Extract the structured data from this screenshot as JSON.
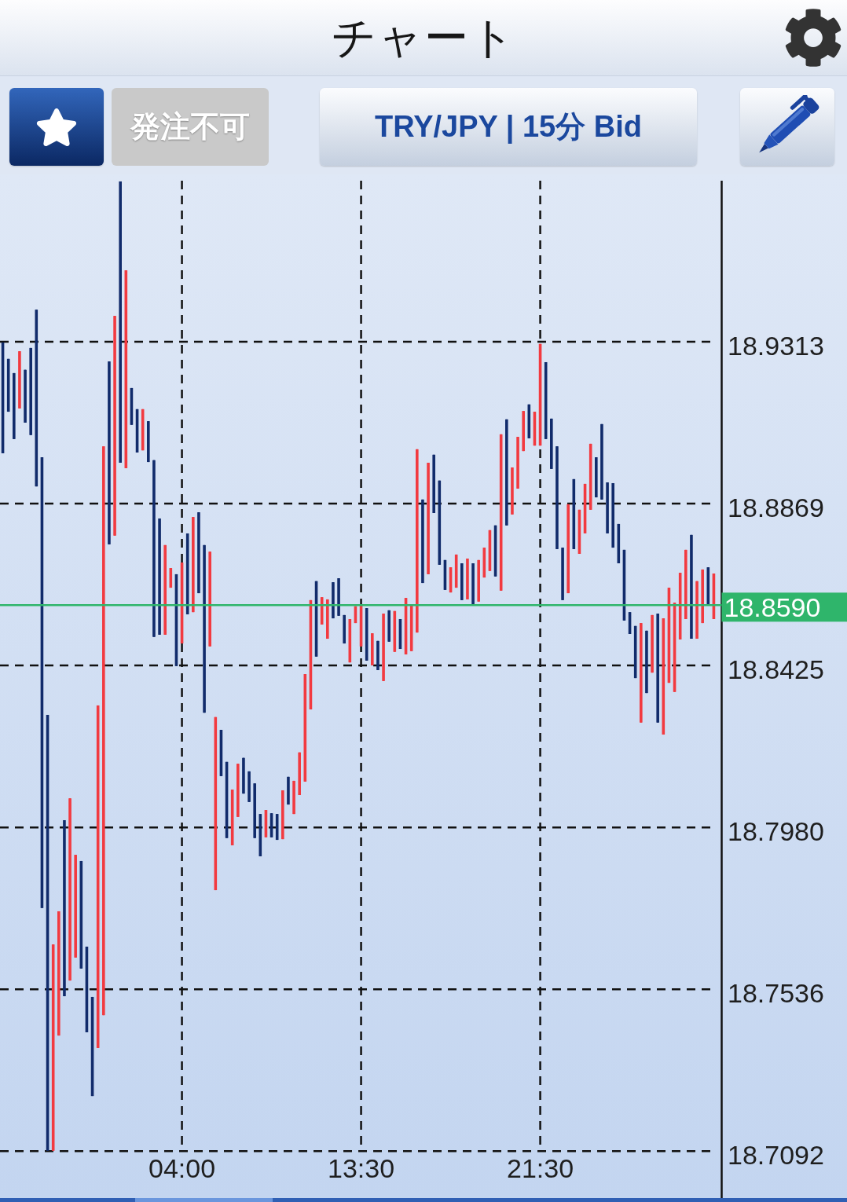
{
  "header": {
    "title": "チャート"
  },
  "toolbar": {
    "order_button": {
      "label": "発注不可",
      "disabled": true
    },
    "symbol_button": {
      "label": "TRY/JPY | 15分 Bid"
    }
  },
  "chart": {
    "chart_data": {
      "type": "candlestick",
      "grid": true,
      "ylim": [
        18.6963,
        18.9755
      ],
      "categories": [
        null,
        null,
        null,
        null,
        null,
        null,
        null,
        null,
        null,
        null,
        null,
        null,
        null,
        null,
        null,
        null,
        null,
        null,
        null,
        null,
        null,
        null,
        null,
        null,
        null,
        null,
        null,
        null,
        null,
        null,
        null,
        null,
        "04:00",
        null,
        null,
        null,
        null,
        null,
        null,
        null,
        null,
        null,
        null,
        null,
        null,
        null,
        null,
        null,
        null,
        null,
        null,
        null,
        null,
        null,
        null,
        null,
        null,
        null,
        null,
        null,
        null,
        null,
        null,
        null,
        "13:30",
        null,
        null,
        null,
        null,
        null,
        null,
        null,
        null,
        null,
        null,
        null,
        null,
        null,
        null,
        null,
        null,
        null,
        null,
        null,
        null,
        null,
        null,
        null,
        null,
        null,
        null,
        null,
        null,
        null,
        null,
        null,
        "21:30",
        null,
        null,
        null,
        null,
        null,
        null,
        null,
        null,
        null,
        null,
        null,
        null,
        null,
        null,
        null,
        null,
        null,
        null,
        null,
        null,
        null,
        null,
        null,
        null,
        null,
        null,
        null,
        null,
        null,
        null,
        null
      ],
      "yticks": [
        {
          "value": 18.9313,
          "label": "18.9313"
        },
        {
          "value": 18.8869,
          "label": "18.8869"
        },
        {
          "value": 18.8425,
          "label": "18.8425"
        },
        {
          "value": 18.798,
          "label": "18.7980"
        },
        {
          "value": 18.7536,
          "label": "18.7536"
        },
        {
          "value": 18.7092,
          "label": "18.7092"
        }
      ],
      "series": [
        {
          "ohlc": [
            [
              18.9311,
              18.9311,
              18.9007,
              18.9007
            ],
            [
              18.9266,
              18.9266,
              18.9121,
              18.9121
            ],
            [
              18.9227,
              18.9227,
              18.9046,
              18.9046
            ],
            [
              18.913,
              18.9287,
              18.913,
              18.9287
            ],
            [
              18.9236,
              18.9236,
              18.9091,
              18.9091
            ],
            [
              18.9296,
              18.9296,
              18.9057,
              18.9057
            ],
            [
              18.9401,
              18.9401,
              18.8916,
              18.8916
            ],
            [
              18.8996,
              18.8996,
              18.7759,
              18.7759
            ],
            [
              18.8289,
              18.8289,
              18.7093,
              18.7093
            ],
            [
              18.7093,
              18.7659,
              18.7093,
              18.7659
            ],
            [
              18.7409,
              18.775,
              18.7409,
              18.775
            ],
            [
              18.8,
              18.8,
              18.7517,
              18.7517
            ],
            [
              18.756,
              18.806,
              18.756,
              18.806
            ],
            [
              18.7623,
              18.7905,
              18.7623,
              18.7905
            ],
            [
              18.7888,
              18.7888,
              18.7593,
              18.7593
            ],
            [
              18.7653,
              18.7653,
              18.7418,
              18.7418
            ],
            [
              18.7515,
              18.7515,
              18.7243,
              18.7243
            ],
            [
              18.7375,
              18.8315,
              18.7375,
              18.8315
            ],
            [
              18.7465,
              18.9026,
              18.7465,
              18.9026
            ],
            [
              18.9259,
              18.9259,
              18.8757,
              18.8757
            ],
            [
              18.8781,
              18.9384,
              18.8781,
              18.9384
            ],
            [
              18.9753,
              18.9753,
              18.8981,
              18.8981
            ],
            [
              18.8966,
              18.9509,
              18.8966,
              18.9509
            ],
            [
              18.9186,
              18.9186,
              18.9085,
              18.9085
            ],
            [
              18.9128,
              18.9128,
              18.9009,
              18.9009
            ],
            [
              18.9015,
              18.9128,
              18.9015,
              18.9128
            ],
            [
              18.9095,
              18.9095,
              18.8983,
              18.8983
            ],
            [
              18.8988,
              18.8988,
              18.8503,
              18.8503
            ],
            [
              18.8828,
              18.8828,
              18.8509,
              18.8509
            ],
            [
              18.8509,
              18.8755,
              18.8509,
              18.8755
            ],
            [
              18.8638,
              18.8692,
              18.8638,
              18.8692
            ],
            [
              18.8675,
              18.8675,
              18.8423,
              18.8423
            ],
            [
              18.8485,
              18.8707,
              18.8485,
              18.8707
            ],
            [
              18.8787,
              18.8787,
              18.8565,
              18.8565
            ],
            [
              18.8571,
              18.8832,
              18.8571,
              18.8832
            ],
            [
              18.8845,
              18.8845,
              18.8623,
              18.8623
            ],
            [
              18.8755,
              18.8755,
              18.8295,
              18.8295
            ],
            [
              18.8477,
              18.8737,
              18.8477,
              18.8737
            ],
            [
              18.7808,
              18.8283,
              18.7808,
              18.8283
            ],
            [
              18.8248,
              18.8248,
              18.8121,
              18.8121
            ],
            [
              18.816,
              18.816,
              18.7951,
              18.7951
            ],
            [
              18.7931,
              18.8084,
              18.7931,
              18.8084
            ],
            [
              18.8009,
              18.8155,
              18.8009,
              18.8155
            ],
            [
              18.8171,
              18.8171,
              18.8073,
              18.8073
            ],
            [
              18.8134,
              18.8134,
              18.805,
              18.805
            ],
            [
              18.8101,
              18.8101,
              18.7951,
              18.7951
            ],
            [
              18.8017,
              18.8017,
              18.7901,
              18.7901
            ],
            [
              18.7953,
              18.8028,
              18.7953,
              18.8028
            ],
            [
              18.8019,
              18.8019,
              18.7953,
              18.7953
            ],
            [
              18.8017,
              18.8017,
              18.7946,
              18.7946
            ],
            [
              18.7948,
              18.8082,
              18.7948,
              18.8082
            ],
            [
              18.8119,
              18.8119,
              18.8043,
              18.8043
            ],
            [
              18.8017,
              18.8108,
              18.8017,
              18.8108
            ],
            [
              18.8069,
              18.8186,
              18.8069,
              18.8186
            ],
            [
              18.8106,
              18.8401,
              18.8106,
              18.8401
            ],
            [
              18.8304,
              18.8604,
              18.8304,
              18.8604
            ],
            [
              18.8656,
              18.8656,
              18.8449,
              18.8449
            ],
            [
              18.8537,
              18.8612,
              18.8537,
              18.8612
            ],
            [
              18.8498,
              18.8606,
              18.8498,
              18.8606
            ],
            [
              18.8653,
              18.8653,
              18.8554,
              18.8554
            ],
            [
              18.8664,
              18.8664,
              18.8561,
              18.8561
            ],
            [
              18.8563,
              18.8563,
              18.8485,
              18.8485
            ],
            [
              18.8433,
              18.8552,
              18.8433,
              18.8552
            ],
            [
              18.8541,
              18.8587,
              18.8541,
              18.8587
            ],
            [
              18.8477,
              18.8591,
              18.8477,
              18.8591
            ],
            [
              18.8582,
              18.8582,
              18.8438,
              18.8438
            ],
            [
              18.8425,
              18.8513,
              18.8425,
              18.8513
            ],
            [
              18.8492,
              18.8492,
              18.8412,
              18.8412
            ],
            [
              18.8382,
              18.8567,
              18.8382,
              18.8567
            ],
            [
              18.8576,
              18.8576,
              18.849,
              18.849
            ],
            [
              18.8462,
              18.8574,
              18.8462,
              18.8574
            ],
            [
              18.8552,
              18.8552,
              18.847,
              18.847
            ],
            [
              18.8455,
              18.861,
              18.8455,
              18.861
            ],
            [
              18.8464,
              18.8591,
              18.8464,
              18.8591
            ],
            [
              18.8515,
              18.9018,
              18.8515,
              18.9018
            ],
            [
              18.888,
              18.888,
              18.8651,
              18.8651
            ],
            [
              18.8675,
              18.8981,
              18.8675,
              18.8981
            ],
            [
              18.9003,
              18.9003,
              18.8843,
              18.8843
            ],
            [
              18.8932,
              18.8932,
              18.8701,
              18.8701
            ],
            [
              18.8714,
              18.8714,
              18.8632,
              18.8632
            ],
            [
              18.8625,
              18.8694,
              18.8625,
              18.8694
            ],
            [
              18.8638,
              18.8729,
              18.8638,
              18.8729
            ],
            [
              18.8705,
              18.8705,
              18.8604,
              18.8604
            ],
            [
              18.8606,
              18.8718,
              18.8606,
              18.8718
            ],
            [
              18.8705,
              18.8705,
              18.8593,
              18.8593
            ],
            [
              18.86,
              18.8714,
              18.86,
              18.8714
            ],
            [
              18.8666,
              18.8748,
              18.8666,
              18.8748
            ],
            [
              18.8684,
              18.8796,
              18.8684,
              18.8796
            ],
            [
              18.8809,
              18.8809,
              18.8669,
              18.8669
            ],
            [
              18.863,
              18.9059,
              18.863,
              18.9059
            ],
            [
              18.91,
              18.91,
              18.8809,
              18.8809
            ],
            [
              18.8839,
              18.8968,
              18.8839,
              18.8968
            ],
            [
              18.891,
              18.9052,
              18.891,
              18.9052
            ],
            [
              18.9013,
              18.9123,
              18.9013,
              18.9123
            ],
            [
              18.9141,
              18.9141,
              18.9048,
              18.9048
            ],
            [
              18.9028,
              18.9121,
              18.9028,
              18.9121
            ],
            [
              18.9028,
              18.9307,
              18.9028,
              18.9307
            ],
            [
              18.9257,
              18.9257,
              18.9046,
              18.9046
            ],
            [
              18.9102,
              18.9102,
              18.8964,
              18.8964
            ],
            [
              18.9026,
              18.9026,
              18.8744,
              18.8744
            ],
            [
              18.8748,
              18.8748,
              18.8604,
              18.8604
            ],
            [
              18.8623,
              18.8867,
              18.8623,
              18.8867
            ],
            [
              18.8936,
              18.8936,
              18.8744,
              18.8744
            ],
            [
              18.8731,
              18.8852,
              18.8731,
              18.8852
            ],
            [
              18.8787,
              18.8923,
              18.8787,
              18.8923
            ],
            [
              18.8852,
              18.9033,
              18.8852,
              18.9033
            ],
            [
              18.8996,
              18.8996,
              18.8886,
              18.8886
            ],
            [
              18.9087,
              18.9087,
              18.888,
              18.888
            ],
            [
              18.8927,
              18.8927,
              18.8787,
              18.8787
            ],
            [
              18.8925,
              18.8925,
              18.8748,
              18.8748
            ],
            [
              18.8813,
              18.8813,
              18.8705,
              18.8705
            ],
            [
              18.8742,
              18.8742,
              18.8548,
              18.8548
            ],
            [
              18.8571,
              18.8571,
              18.8511,
              18.8511
            ],
            [
              18.8533,
              18.8533,
              18.839,
              18.839
            ],
            [
              18.8268,
              18.8541,
              18.8268,
              18.8541
            ],
            [
              18.852,
              18.852,
              18.8349,
              18.8349
            ],
            [
              18.8405,
              18.8563,
              18.8405,
              18.8563
            ],
            [
              18.8567,
              18.8567,
              18.8268,
              18.8268
            ],
            [
              18.8235,
              18.8554,
              18.8235,
              18.8554
            ],
            [
              18.8377,
              18.8638,
              18.8377,
              18.8638
            ],
            [
              18.8352,
              18.8597,
              18.8352,
              18.8597
            ],
            [
              18.8496,
              18.8679,
              18.8496,
              18.8679
            ],
            [
              18.8552,
              18.8742,
              18.8552,
              18.8742
            ],
            [
              18.8783,
              18.8783,
              18.8498,
              18.8498
            ],
            [
              18.8498,
              18.8656,
              18.8498,
              18.8656
            ],
            [
              18.8541,
              18.8688,
              18.8541,
              18.8688
            ],
            [
              18.8694,
              18.8694,
              18.8591,
              18.8591
            ],
            [
              18.8552,
              18.8677,
              18.8552,
              18.8677
            ]
          ]
        }
      ],
      "ref_lines": [
        {
          "axis": "y",
          "value": 18.859,
          "label": "18.8590",
          "color": "#2fb56b"
        }
      ]
    }
  }
}
